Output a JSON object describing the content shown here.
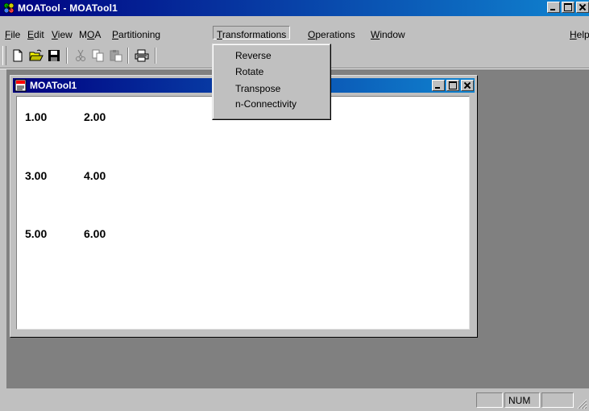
{
  "app": {
    "title": "MOATool - MOATool1"
  },
  "menubar": {
    "items": [
      {
        "label": "File",
        "mnemonic_index": 0
      },
      {
        "label": "Edit",
        "mnemonic_index": 0
      },
      {
        "label": "View",
        "mnemonic_index": 0
      },
      {
        "label": "MOA",
        "mnemonic_index": 1
      },
      {
        "label": "Partitioning",
        "mnemonic_index": 0
      },
      {
        "label": "Transformations",
        "mnemonic_index": 0
      },
      {
        "label": "Operations",
        "mnemonic_index": 0
      },
      {
        "label": "Window",
        "mnemonic_index": 0
      }
    ],
    "help": "Help"
  },
  "toolbar": {
    "buttons": [
      "new-icon",
      "open-icon",
      "save-icon",
      "cut-icon",
      "copy-icon",
      "paste-icon",
      "print-icon"
    ]
  },
  "dropdown": {
    "items": [
      "Reverse",
      "Rotate",
      "Transpose",
      "n-Connectivity"
    ]
  },
  "child_window": {
    "title": "MOATool1",
    "values": [
      [
        "1.00",
        "2.00"
      ],
      [
        "3.00",
        "4.00"
      ],
      [
        "5.00",
        "6.00"
      ]
    ]
  },
  "statusbar": {
    "message": "",
    "panes": [
      "",
      "NUM",
      ""
    ]
  },
  "colors": {
    "titlebar_start": "#000080",
    "titlebar_end": "#1084d0",
    "face": "#c0c0c0",
    "mdi_background": "#808080"
  }
}
